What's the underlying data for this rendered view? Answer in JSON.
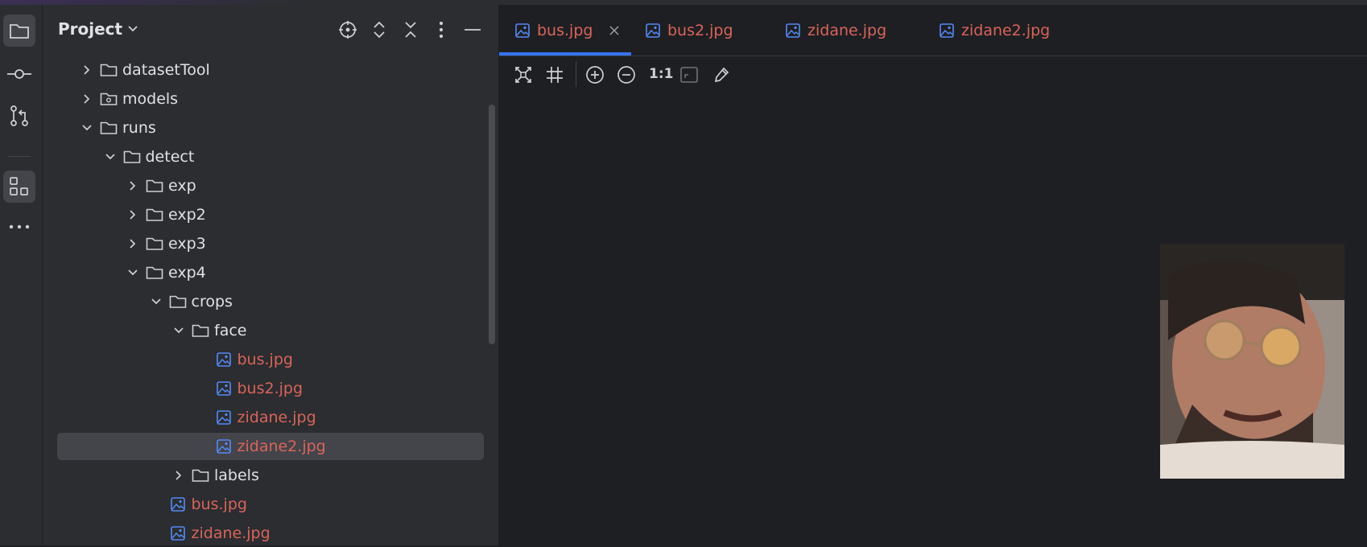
{
  "sidebar": {
    "icons": [
      "folder-icon",
      "commit-icon",
      "pull-request-icon",
      "structure-icon",
      "more-icon"
    ]
  },
  "project": {
    "title": "Project",
    "actions": [
      "locate-icon",
      "expand-all-icon",
      "collapse-all-icon",
      "options-icon",
      "hide-icon"
    ]
  },
  "tree": [
    {
      "label": "datasetTool",
      "type": "folder",
      "expanded": false,
      "level": 1
    },
    {
      "label": "models",
      "type": "module",
      "expanded": false,
      "level": 1
    },
    {
      "label": "runs",
      "type": "folder",
      "expanded": true,
      "level": 1
    },
    {
      "label": "detect",
      "type": "folder",
      "expanded": true,
      "level": 2
    },
    {
      "label": "exp",
      "type": "folder",
      "expanded": false,
      "level": 3
    },
    {
      "label": "exp2",
      "type": "folder",
      "expanded": false,
      "level": 3
    },
    {
      "label": "exp3",
      "type": "folder",
      "expanded": false,
      "level": 3
    },
    {
      "label": "exp4",
      "type": "folder",
      "expanded": true,
      "level": 3
    },
    {
      "label": "crops",
      "type": "folder",
      "expanded": true,
      "level": 4
    },
    {
      "label": "face",
      "type": "folder",
      "expanded": true,
      "level": 5
    },
    {
      "label": "bus.jpg",
      "type": "image",
      "level": 6
    },
    {
      "label": "bus2.jpg",
      "type": "image",
      "level": 6
    },
    {
      "label": "zidane.jpg",
      "type": "image",
      "level": 6
    },
    {
      "label": "zidane2.jpg",
      "type": "image",
      "level": 6,
      "selected": true
    },
    {
      "label": "labels",
      "type": "folder",
      "expanded": false,
      "level": 5
    },
    {
      "label": "bus.jpg",
      "type": "image",
      "level": 4
    },
    {
      "label": "zidane.jpg",
      "type": "image",
      "level": 4
    }
  ],
  "tabs": [
    {
      "label": "bus.jpg",
      "active": true,
      "closable": true
    },
    {
      "label": "bus2.jpg"
    },
    {
      "label": "zidane.jpg"
    },
    {
      "label": "zidane2.jpg"
    }
  ],
  "toolbar": {
    "zoom_actual": "1:1",
    "icons": [
      "fit-to-window-icon",
      "grid-icon",
      "zoom-in-icon",
      "zoom-out-icon",
      "fit-zoom-icon",
      "color-picker-icon"
    ]
  },
  "colors": {
    "accent": "#3574f0",
    "file_text": "#d9645a",
    "panel_bg": "#2b2d30",
    "editor_bg": "#1e1f22",
    "selection": "#43454a"
  }
}
